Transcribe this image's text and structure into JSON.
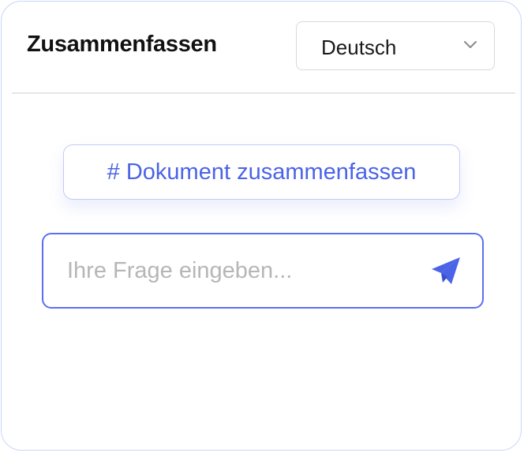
{
  "header": {
    "title": "Zusammenfassen",
    "language": {
      "selected": "Deutsch",
      "icon": "chevron-down-icon"
    }
  },
  "actions": {
    "summarize_chip_label": "# Dokument zusammenfassen"
  },
  "question": {
    "value": "",
    "placeholder": "Ihre Frage eingeben...",
    "send_icon": "send-icon"
  },
  "colors": {
    "accent": "#4b63e6",
    "input_border": "#5a6ff0",
    "panel_border": "#ccd3fb",
    "placeholder": "#b6b6b6",
    "title": "#111111"
  }
}
